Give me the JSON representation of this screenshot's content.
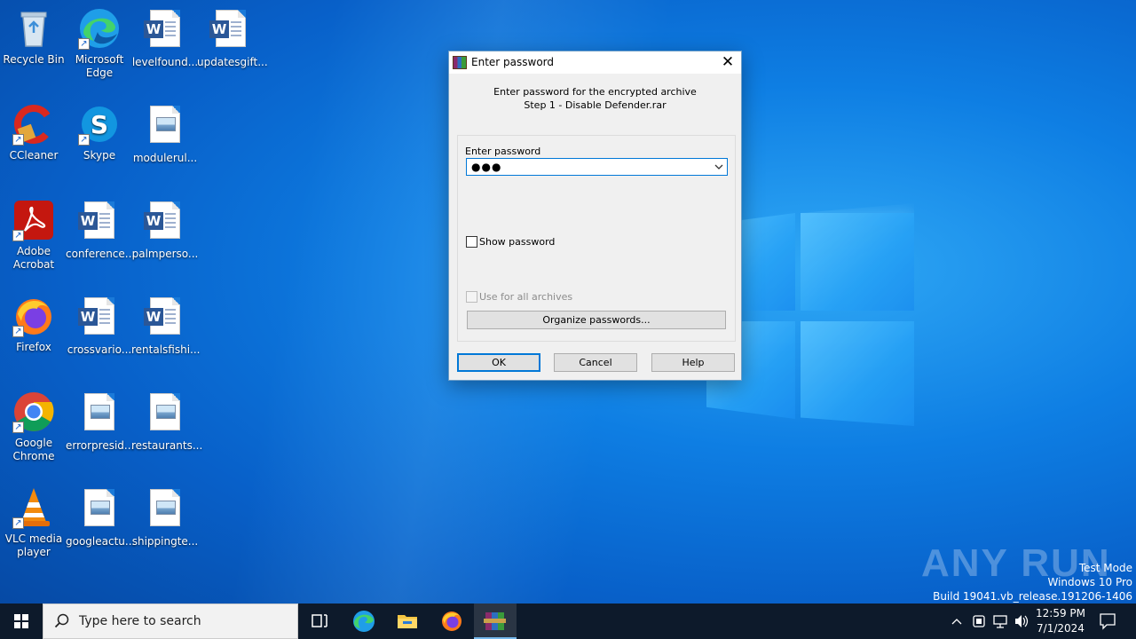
{
  "desktop": {
    "icons": [
      {
        "label": "Recycle Bin",
        "kind": "recycle-bin"
      },
      {
        "label": "Microsoft Edge",
        "kind": "edge"
      },
      {
        "label": "levelfound...",
        "kind": "word"
      },
      {
        "label": "updatesgift...",
        "kind": "word"
      },
      {
        "label": "CCleaner",
        "kind": "ccleaner"
      },
      {
        "label": "Skype",
        "kind": "skype"
      },
      {
        "label": "modulerul...",
        "kind": "image"
      },
      {
        "label": "Adobe Acrobat",
        "kind": "acrobat"
      },
      {
        "label": "conference...",
        "kind": "word"
      },
      {
        "label": "palmperso...",
        "kind": "word"
      },
      {
        "label": "Firefox",
        "kind": "firefox"
      },
      {
        "label": "crossvario...",
        "kind": "word"
      },
      {
        "label": "rentalsfishi...",
        "kind": "word"
      },
      {
        "label": "Google Chrome",
        "kind": "chrome"
      },
      {
        "label": "errorpresid...",
        "kind": "image"
      },
      {
        "label": "restaurants...",
        "kind": "image"
      },
      {
        "label": "VLC media player",
        "kind": "vlc"
      },
      {
        "label": "googleactu...",
        "kind": "image"
      },
      {
        "label": "shippingte...",
        "kind": "image"
      }
    ]
  },
  "dialog": {
    "title": "Enter password",
    "message_line1": "Enter password for the encrypted archive",
    "message_line2": "Step 1 - Disable Defender.rar",
    "password_label": "Enter password",
    "password_value": "●●●",
    "show_password_label": "Show password",
    "use_for_all_label": "Use for all archives",
    "organize_label": "Organize passwords...",
    "ok_label": "OK",
    "cancel_label": "Cancel",
    "help_label": "Help",
    "close_glyph": "✕"
  },
  "watermark": {
    "brand": "ANY RUN",
    "line1": "Test Mode",
    "line2": "Windows 10 Pro",
    "line3": "Build 19041.vb_release.191206-1406"
  },
  "taskbar": {
    "search_placeholder": "Type here to search",
    "time": "12:59 PM",
    "date": "7/1/2024",
    "pinned": [
      "task-view",
      "edge",
      "file-explorer",
      "firefox",
      "winrar"
    ]
  },
  "colors": {
    "accent": "#0078d7",
    "taskbar": "#0d1a2b",
    "desktop": "#0e7ee3"
  }
}
